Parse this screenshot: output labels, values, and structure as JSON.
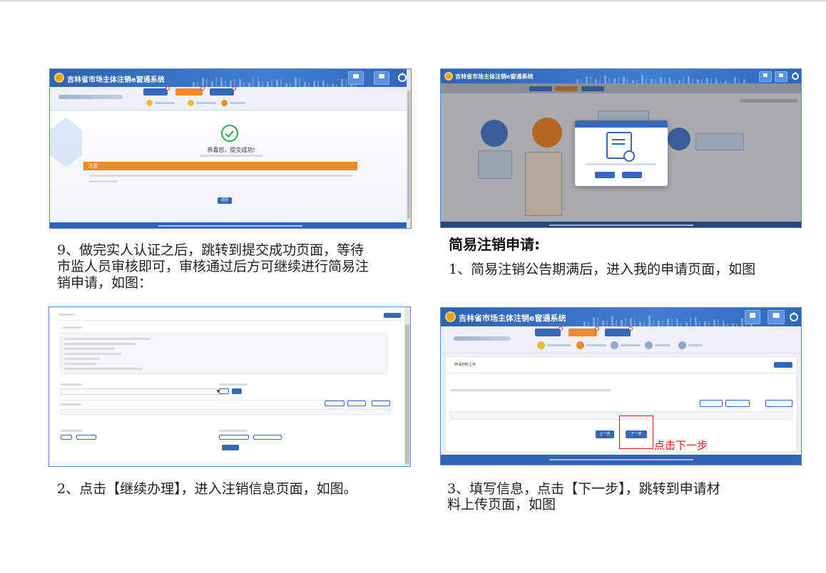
{
  "system": {
    "title": "吉林省市场主体注销e窗通系统",
    "header_buttons": [
      "首页",
      "我的申请"
    ]
  },
  "screenshots": {
    "s1": {
      "success_title": "恭喜您，提交成功!",
      "notice_label": "注意",
      "return_button": "返回"
    },
    "s4": {
      "section_title": "申请材料上传",
      "prev_button": "上一步",
      "next_button": "下一步",
      "click_hint": "点击下一步"
    }
  },
  "captions": {
    "c9_line1": "9、做完实人认证之后，跳转到提交成功页面，等待",
    "c9_line2": "市监人员审核即可，审核通过后方可继续进行简易注",
    "c9_line3": "销申请，如图：",
    "simple_heading": "简易注销申请:",
    "c1": "1、简易注销公告期满后，进入我的申请页面，如图",
    "c2": "2、点击【继续办理】，进入注销信息页面，如图。",
    "c3_line1": "3、填写信息，点击【下一步】，跳转到申请材",
    "c3_line2": "料上传页面，如图"
  }
}
